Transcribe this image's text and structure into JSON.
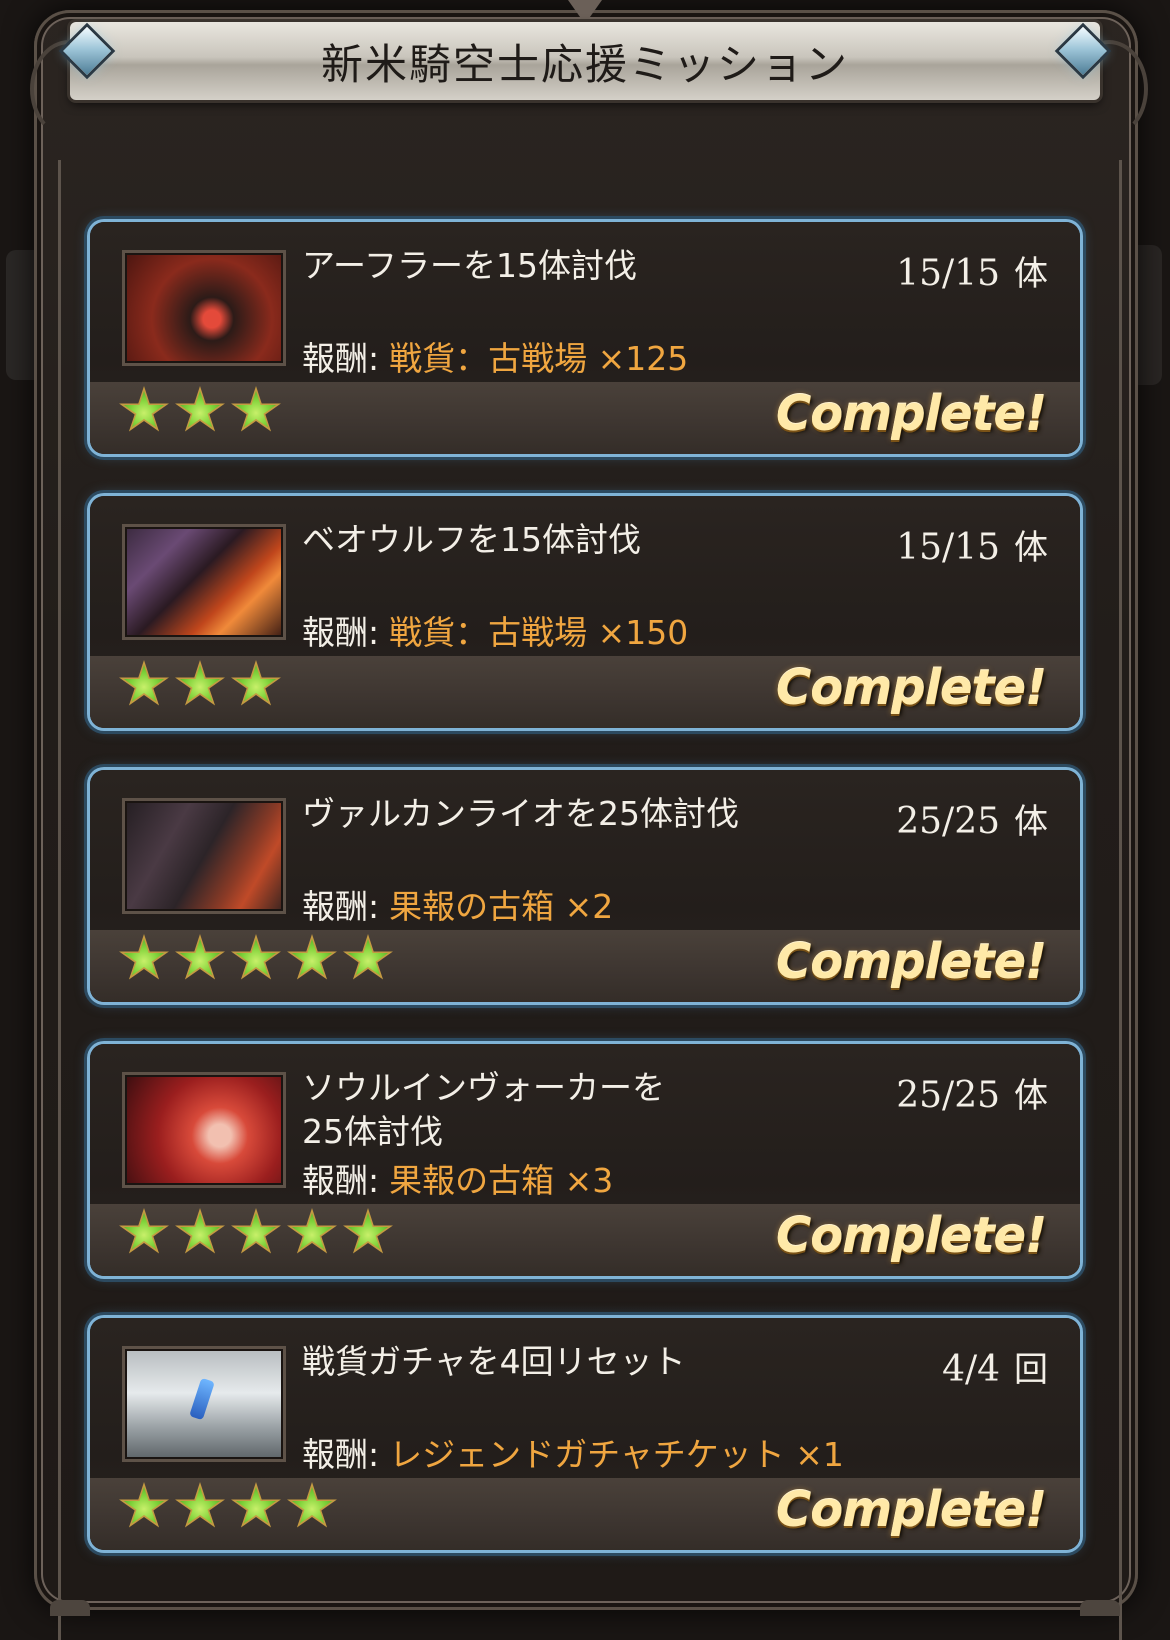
{
  "title": "新米騎空士応援ミッション",
  "missions": [
    {
      "title": "アーフラーを15体討伐",
      "progress": "15/15",
      "unit": "体",
      "reward_label": "報酬:",
      "reward": "戦貨：古戦場 ×125",
      "stars": 3,
      "status": "Complete!",
      "thumbnail_icon": "aphrah-monster-icon"
    },
    {
      "title": "ベオウルフを15体討伐",
      "progress": "15/15",
      "unit": "体",
      "reward_label": "報酬:",
      "reward": "戦貨：古戦場 ×150",
      "stars": 3,
      "status": "Complete!",
      "thumbnail_icon": "beowulf-monster-icon"
    },
    {
      "title": "ヴァルカンライオを25体討伐",
      "progress": "25/25",
      "unit": "体",
      "reward_label": "報酬:",
      "reward": "果報の古箱 ×2",
      "stars": 5,
      "status": "Complete!",
      "thumbnail_icon": "vulcan-lion-monster-icon"
    },
    {
      "title": "ソウルインヴォーカーを\n25体討伐",
      "progress": "25/25",
      "unit": "体",
      "reward_label": "報酬:",
      "reward": "果報の古箱 ×3",
      "stars": 5,
      "status": "Complete!",
      "thumbnail_icon": "soul-invoker-character-icon"
    },
    {
      "title": "戦貨ガチャを4回リセット",
      "progress": "4/4",
      "unit": "回",
      "reward_label": "報酬:",
      "reward": "レジェンドガチャチケット ×1",
      "stars": 4,
      "status": "Complete!",
      "thumbnail_icon": "gacha-reset-icon"
    }
  ],
  "colors": {
    "card_border": "#7fb3d6",
    "reward_text": "#f0a640",
    "complete_text": "#ffe9a8",
    "star_fill": "#7fd23a"
  }
}
